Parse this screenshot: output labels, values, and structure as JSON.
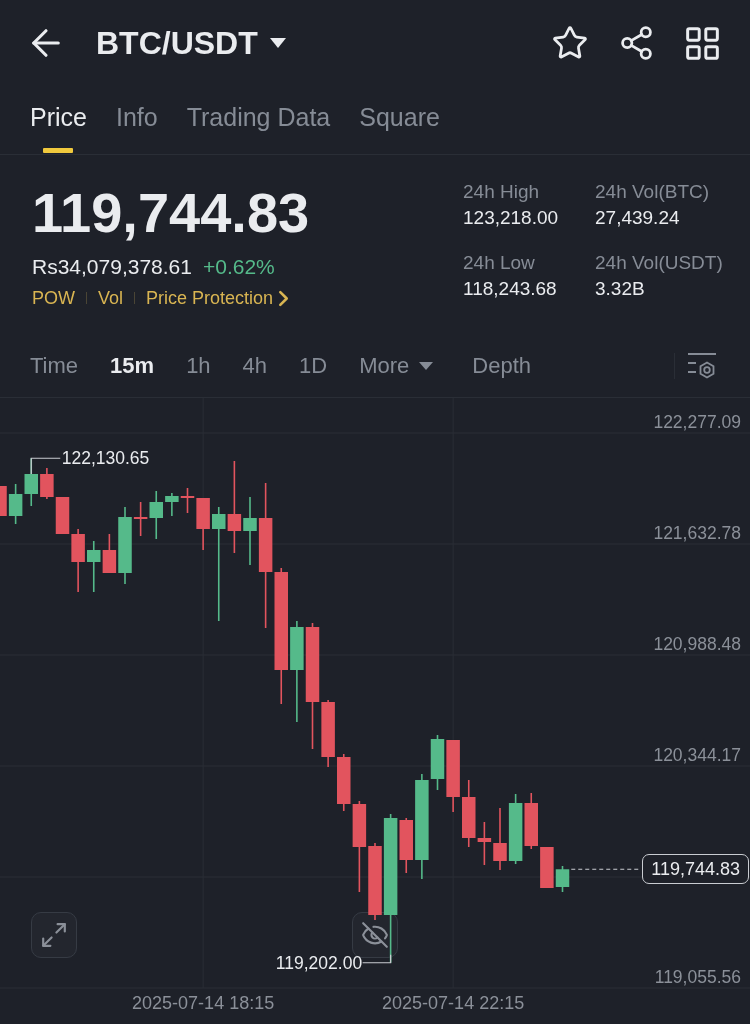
{
  "header": {
    "title": "BTC/USDT"
  },
  "tabs": [
    {
      "label": "Price",
      "selected": true
    },
    {
      "label": "Info",
      "selected": false
    },
    {
      "label": "Trading Data",
      "selected": false
    },
    {
      "label": "Square",
      "selected": false
    }
  ],
  "price": {
    "last": "119,744.83",
    "fiat": "Rs34,079,378.61",
    "change": "+0.62%"
  },
  "tags": [
    {
      "label": "POW",
      "kind": "tag"
    },
    {
      "label": "Vol",
      "kind": "tag"
    },
    {
      "label": "Price Protection",
      "kind": "link"
    }
  ],
  "stats": [
    {
      "label": "24h High",
      "value": "123,218.00"
    },
    {
      "label": "24h Vol(BTC)",
      "value": "27,439.24"
    },
    {
      "label": "24h Low",
      "value": "118,243.68"
    },
    {
      "label": "24h Vol(USDT)",
      "value": "3.32B"
    }
  ],
  "intervals": [
    {
      "label": "Time",
      "kind": "option",
      "selected": false
    },
    {
      "label": "15m",
      "kind": "option",
      "selected": true
    },
    {
      "label": "1h",
      "kind": "option",
      "selected": false
    },
    {
      "label": "4h",
      "kind": "option",
      "selected": false
    },
    {
      "label": "1D",
      "kind": "option",
      "selected": false
    },
    {
      "label": "More",
      "kind": "menu",
      "selected": false
    },
    {
      "label": "Depth",
      "kind": "option",
      "selected": false
    }
  ],
  "chart": {
    "chart_data": {
      "type": "candlestick",
      "grid": true,
      "categories": [
        null,
        null,
        null,
        null,
        null,
        null,
        null,
        null,
        null,
        null,
        null,
        null,
        null,
        "2025-07-14 18:15",
        null,
        null,
        null,
        null,
        null,
        null,
        null,
        null,
        null,
        null,
        null,
        null,
        null,
        null,
        null,
        "2025-07-14 22:15",
        null,
        null,
        null,
        null,
        null,
        null,
        null
      ],
      "ohlc": [
        [
          121969.45,
          121969.45,
          121795.32,
          121795.32
        ],
        [
          121795.32,
          121981.06,
          121748.88,
          121923.02
        ],
        [
          121923.02,
          122130.65,
          121853.36,
          122039.11
        ],
        [
          122039.11,
          122073.93,
          121893.99,
          121905.6
        ],
        [
          121905.6,
          121905.6,
          121690.84,
          121690.84
        ],
        [
          121690.84,
          121719.86,
          121354.17,
          121528.31
        ],
        [
          121528.31,
          121650.2,
          121354.17,
          121597.96
        ],
        [
          121597.96,
          121690.84,
          121464.46,
          121464.46
        ],
        [
          121464.46,
          121847.56,
          121400.61,
          121789.51
        ],
        [
          121789.51,
          121876.58,
          121679.23,
          121777.9
        ],
        [
          121783.71,
          121940.43,
          121661.81,
          121876.58
        ],
        [
          121876.58,
          121928.82,
          121795.32,
          121911.41
        ],
        [
          121911.41,
          121957.84,
          121812.73,
          121899.8
        ],
        [
          121899.8,
          121899.8,
          121597.96,
          121719.86
        ],
        [
          121719.86,
          121847.56,
          121185.84,
          121806.93
        ],
        [
          121806.93,
          122114.56,
          121580.55,
          121708.25
        ],
        [
          121708.25,
          121905.6,
          121510.9,
          121783.71
        ],
        [
          121783.71,
          121986.86,
          121145.21,
          121470.26
        ],
        [
          121470.26,
          121493.48,
          120704.07,
          120901.42
        ],
        [
          120901.42,
          121185.84,
          120599.59,
          121151.02
        ],
        [
          121151.02,
          121174.23,
          120442.87,
          120715.68
        ],
        [
          120715.68,
          120727.29,
          120338.39,
          120396.43
        ],
        [
          120396.43,
          120413.85,
          120082.99,
          120123.62
        ],
        [
          120123.62,
          120141.03,
          119612.82,
          119874.03
        ],
        [
          119879.83,
          119897.24,
          119450.3,
          119479.32
        ],
        [
          119479.32,
          120065.58,
          119202.0,
          120042.36
        ],
        [
          120030.75,
          120042.36,
          119723.11,
          119798.57
        ],
        [
          119798.57,
          120297.76,
          119688.28,
          120262.93
        ],
        [
          120268.73,
          120524.13,
          120204.88,
          120500.91
        ],
        [
          120495.11,
          120495.11,
          120077.18,
          120164.25
        ],
        [
          120164.25,
          120262.93,
          119874.03,
          119926.27
        ],
        [
          119926.27,
          120019.14,
          119769.55,
          119903.05
        ],
        [
          119897.24,
          120100.4,
          119740.52,
          119792.76
        ],
        [
          119792.76,
          120181.67,
          119775.35,
          120129.42
        ],
        [
          120129.42,
          120187.47,
          119862.42,
          119879.83
        ],
        [
          119874.03,
          119874.03,
          119636.04,
          119636.04
        ],
        [
          119641.85,
          119763.74,
          119612.82,
          119744.83
        ]
      ],
      "ylim": [
        119055.56,
        122480.25
      ],
      "yticks": [
        {
          "value": 122277.09,
          "label": "122,277.09"
        },
        {
          "value": 121632.78,
          "label": "121,632.78"
        },
        {
          "value": 120988.48,
          "label": "120,988.48"
        },
        {
          "value": 120344.17,
          "label": "120,344.17"
        },
        {
          "value": 119055.56,
          "label": "119,055.56"
        }
      ]
    },
    "high_marker": "122,130.65",
    "low_marker": "119,202.00",
    "last_price": "119,744.83"
  }
}
